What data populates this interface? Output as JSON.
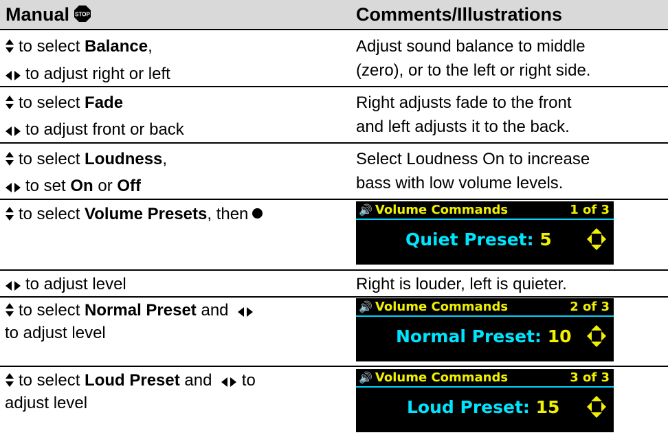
{
  "header": {
    "left": "Manual",
    "stop_icon": "stop-sign-icon",
    "right": "Comments/Illustrations"
  },
  "icons": {
    "up_down": "up-down-arrows-icon",
    "left_right": "left-right-arrows-icon",
    "select": "select-dot-icon",
    "speaker": "speaker-icon",
    "nav": "four-way-arrow-icon"
  },
  "rows": [
    {
      "line1_pre": "to select ",
      "line1_bold": "Balance",
      "line1_post": ",",
      "line2": "to adjust right or left",
      "comment1": "Adjust sound balance to middle",
      "comment2": "(zero), or to the left or right side."
    },
    {
      "line1_pre": "to select ",
      "line1_bold": "Fade",
      "line2": "to adjust front or back",
      "comment1": "Right adjusts fade to the front",
      "comment2": "and left adjusts it to the back."
    },
    {
      "line1_pre": "to select ",
      "line1_bold": "Loudness",
      "line1_post": ",",
      "line2_pre": "to set ",
      "line2_on": "On",
      "line2_mid": " or ",
      "line2_off": "Off",
      "comment1": "Select Loudness On to increase",
      "comment2": "bass with low volume levels."
    },
    {
      "line1_pre": "to select ",
      "line1_bold": "Volume Presets",
      "line1_post": ", then"
    },
    {
      "line1": "to adjust level",
      "comment1": "Right is louder, left is quieter."
    },
    {
      "line1_pre": "to select ",
      "line1_bold": "Normal Preset",
      "line1_post": " and",
      "line2": "to adjust level"
    },
    {
      "line1_pre": "to select ",
      "line1_bold": "Loud Preset",
      "line1_post": " and",
      "line1_tail": " to",
      "line2": "adjust level"
    }
  ],
  "screens": [
    {
      "title": "Volume Commands",
      "page": "1 of 3",
      "label": "Quiet Preset:",
      "value": "5"
    },
    {
      "title": "Volume Commands",
      "page": "2 of 3",
      "label": "Normal Preset:",
      "value": "10"
    },
    {
      "title": "Volume Commands",
      "page": "3 of 3",
      "label": "Loud Preset:",
      "value": "15"
    }
  ],
  "colors": {
    "header_bg": "#d9d9d9",
    "screen_bg": "#000000",
    "screen_yellow": "#f0f000",
    "screen_cyan": "#00e5ff"
  }
}
